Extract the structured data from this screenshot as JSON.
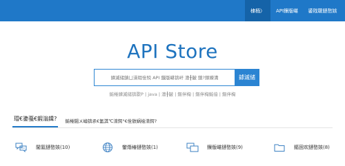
{
  "nav": {
    "items": [
      {
        "label": "棣栭〉",
        "active": true
      },
      {
        "label": "API鏁版嵁",
        "active": false
      },
      {
        "label": "鍙戝竷鏈嶅姟",
        "active": false
      }
    ]
  },
  "logo": {
    "text": "API Store"
  },
  "search": {
    "placeholder": "鎼滅储鎮ㄩ渶瑕佺殑 API 鏁版嵁锛屽 澶╂皵 鎴?鎵嬫満",
    "button_label": "鎼滅储"
  },
  "hotwords": {
    "text": "鐑棬鎼滅储锛欼P  |  java  |  澶╂皵  |  鏂伴椈  |  鏂伴椈鐑偣  |  鏂伴椈"
  },
  "tabs": {
    "items": [
      {
        "label": "瑁€鍌戞€鍜滃鍓?",
        "active": true
      },
      {
        "label": "鐑棬鎺ㄨ崘锛氶€氳淇℃湇鍔°€佺敓娲绘湇鍔?",
        "active": false
      }
    ]
  },
  "categories": [
    {
      "icon": "chat-bubbles-icon",
      "label": "閫氳鏈嶅姟(10)"
    },
    {
      "icon": "globe-icon",
      "label": "鐢熸椿鏈嶅姟(1)"
    },
    {
      "icon": "chat-boxes-icon",
      "label": "鏁版嵁鏈嶅姟(9)"
    },
    {
      "icon": "folder-icon",
      "label": "鏂囦欢鏈嶅姟(8)"
    }
  ],
  "colors": {
    "primary": "#1f78c8",
    "primary_dark": "#1563a8",
    "icon": "#3a7fc2"
  }
}
